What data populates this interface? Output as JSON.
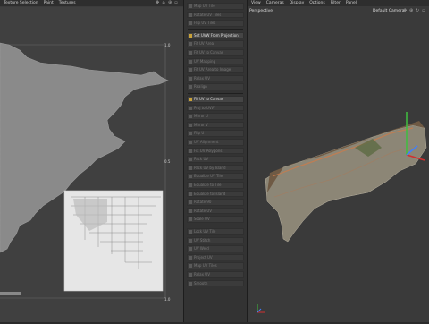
{
  "uv_editor": {
    "menu": [
      "Texture Selection",
      "Paint",
      "Textures"
    ],
    "label_top_right": "1.0",
    "label_right_mid": "0.5",
    "label_bottom_right": "1.0"
  },
  "commands": [
    {
      "label": "Map UV Tile",
      "hl": false
    },
    {
      "label": "Rotate UV Tiles",
      "hl": false
    },
    {
      "label": "Flip UV Tiles",
      "hl": false
    },
    {
      "label": "Set UVW From Projection",
      "hl": true
    },
    {
      "label": "Fit UV Area",
      "hl": false
    },
    {
      "label": "Fit UV to Canvas",
      "hl": false
    },
    {
      "label": "UV Mapping",
      "hl": false
    },
    {
      "label": "Fit UV Area to Image",
      "hl": false
    },
    {
      "label": "Relax UV",
      "hl": false
    },
    {
      "label": "Realign",
      "hl": false
    },
    {
      "label": "Fit UV to Canvas",
      "hl": true
    },
    {
      "label": "Proj to UVW",
      "hl": false
    },
    {
      "label": "Mirror U",
      "hl": false
    },
    {
      "label": "Mirror V",
      "hl": false
    },
    {
      "label": "Flip U",
      "hl": false
    },
    {
      "label": "UV Alignment",
      "hl": false
    },
    {
      "label": "Fix UV Polygons",
      "hl": false
    },
    {
      "label": "Pack UV",
      "hl": false
    },
    {
      "label": "Pack UV by Island",
      "hl": false
    },
    {
      "label": "Equalize UV Tile",
      "hl": false
    },
    {
      "label": "Equalize to Tile",
      "hl": false
    },
    {
      "label": "Equalize to Island",
      "hl": false
    },
    {
      "label": "Rotate 90",
      "hl": false
    },
    {
      "label": "Rotate UV",
      "hl": false
    },
    {
      "label": "Scale UV",
      "hl": false
    },
    {
      "label": "Lock UV Tile",
      "hl": false
    },
    {
      "label": "UV Stitch",
      "hl": false
    },
    {
      "label": "UV Weld",
      "hl": false
    },
    {
      "label": "Project UV",
      "hl": false
    },
    {
      "label": "Map UV Tiles",
      "hl": false
    },
    {
      "label": "Relax UV",
      "hl": false
    },
    {
      "label": "Smooth",
      "hl": false
    }
  ],
  "viewport": {
    "menu": [
      "View",
      "Cameras",
      "Display",
      "Options",
      "Filter",
      "Panel"
    ],
    "view_name": "Perspective",
    "camera": "Default Camera"
  },
  "colors": {
    "selection_axis_y": "#3fbf3f",
    "selection_axis_x": "#d03030",
    "selection_axis_z": "#3f7fff"
  }
}
